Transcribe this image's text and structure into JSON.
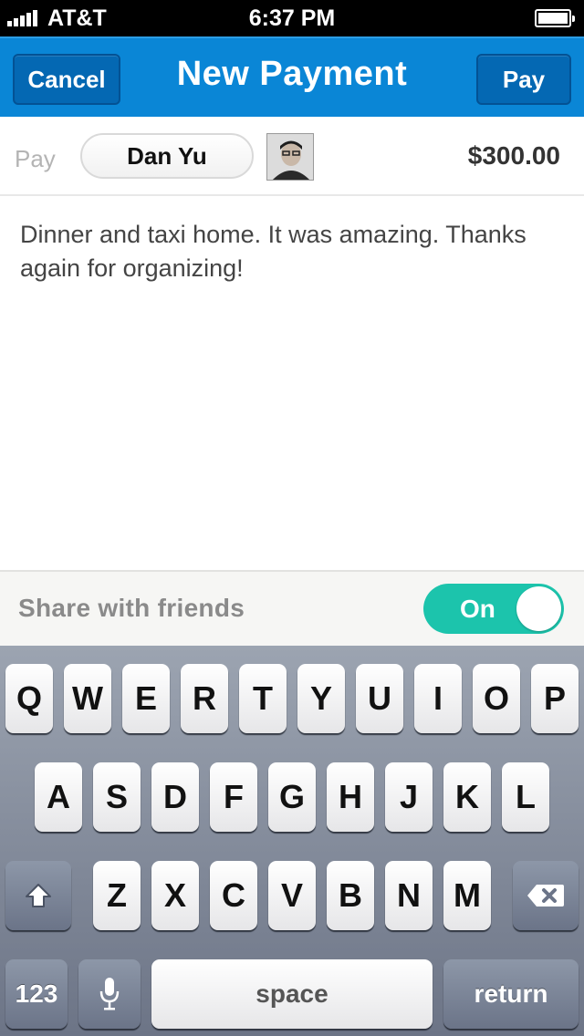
{
  "status_bar": {
    "carrier": "AT&T",
    "time": "6:37 PM"
  },
  "nav": {
    "title": "New Payment",
    "cancel_label": "Cancel",
    "pay_label": "Pay"
  },
  "recipient": {
    "pay_prefix": "Pay",
    "name": "Dan Yu",
    "amount": "$300.00"
  },
  "note": {
    "text": "Dinner and taxi home. It was amazing. Thanks again for organizing!"
  },
  "share": {
    "label": "Share with friends",
    "toggle_label": "On",
    "toggle_color": "#1cc4ac"
  },
  "keyboard": {
    "row1": [
      "Q",
      "W",
      "E",
      "R",
      "T",
      "Y",
      "U",
      "I",
      "O",
      "P"
    ],
    "row2": [
      "A",
      "S",
      "D",
      "F",
      "G",
      "H",
      "J",
      "K",
      "L"
    ],
    "row3": [
      "Z",
      "X",
      "C",
      "V",
      "B",
      "N",
      "M"
    ],
    "numbers_label": "123",
    "space_label": "space",
    "return_label": "return",
    "shift_icon": "shift-arrow-icon",
    "delete_icon": "backspace-icon",
    "mic_icon": "microphone-icon"
  },
  "colors": {
    "nav_blue": "#0a86d6",
    "nav_button_blue": "#0468b3"
  }
}
